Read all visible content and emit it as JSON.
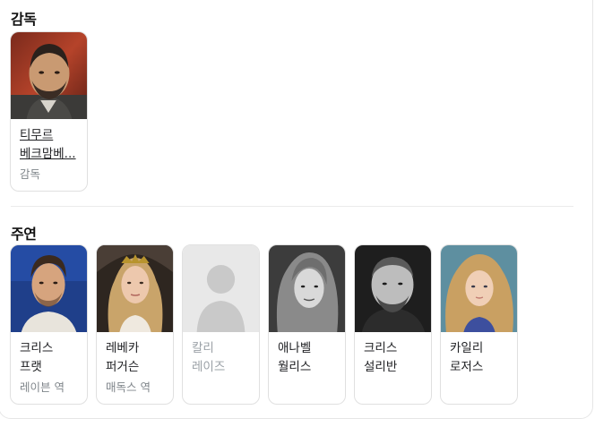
{
  "director_section": {
    "title": "감독",
    "people": [
      {
        "name": "티무르 베크맘베...",
        "role": "감독",
        "photo": "director-photo"
      }
    ]
  },
  "cast_section": {
    "title": "주연",
    "people": [
      {
        "name": "크리스 프랫",
        "role": "레이븐 역",
        "photo": "actor-photo"
      },
      {
        "name": "레베카 퍼거슨",
        "role": "매독스 역",
        "photo": "actor-photo"
      },
      {
        "name": "칼리 레이즈",
        "role": "",
        "photo": "placeholder-silhouette-icon"
      },
      {
        "name": "애나벨 월리스",
        "role": "",
        "photo": "actor-photo"
      },
      {
        "name": "크리스 설리반",
        "role": "",
        "photo": "actor-photo"
      },
      {
        "name": "카일리 로저스",
        "role": "",
        "photo": "actor-photo"
      }
    ]
  },
  "colors": {
    "card_border": "#e0e0e0",
    "muted_text": "#9aa0a6",
    "role_text": "#80868b"
  }
}
